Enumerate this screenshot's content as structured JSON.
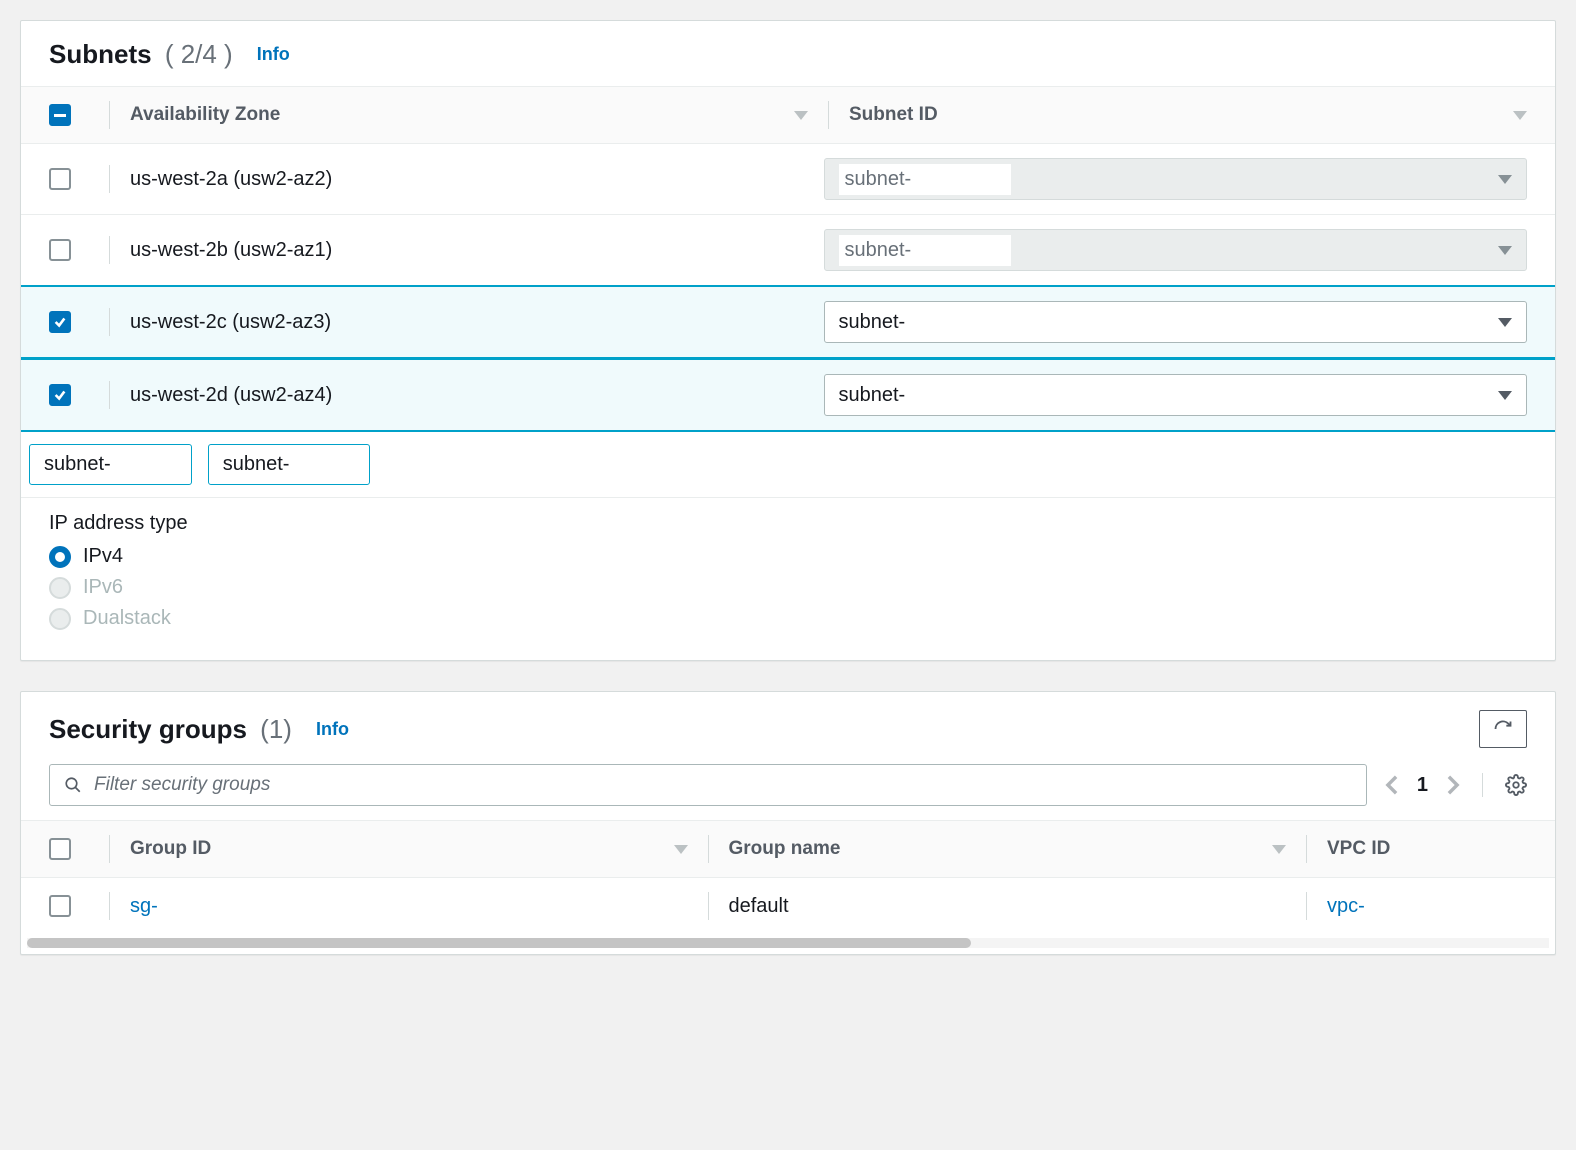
{
  "subnets_panel": {
    "title": "Subnets",
    "count_text": "( 2/4 )",
    "info_label": "Info",
    "columns": {
      "az": "Availability Zone",
      "subnet": "Subnet ID"
    },
    "header_check_state": "indeterminate",
    "rows": [
      {
        "checked": false,
        "az": "us-west-2a (usw2-az2)",
        "subnet_value": "subnet-",
        "disabled": true
      },
      {
        "checked": false,
        "az": "us-west-2b (usw2-az1)",
        "subnet_value": "subnet-",
        "disabled": true
      },
      {
        "checked": true,
        "az": "us-west-2c (usw2-az3)",
        "subnet_value": "subnet-",
        "disabled": false
      },
      {
        "checked": true,
        "az": "us-west-2d (usw2-az4)",
        "subnet_value": "subnet-",
        "disabled": false
      }
    ],
    "tokens": [
      "subnet-",
      "subnet-"
    ],
    "ip_section_title": "IP address type",
    "ip_options": [
      {
        "label": "IPv4",
        "selected": true,
        "disabled": false
      },
      {
        "label": "IPv6",
        "selected": false,
        "disabled": true
      },
      {
        "label": "Dualstack",
        "selected": false,
        "disabled": true
      }
    ]
  },
  "sg_panel": {
    "title": "Security groups",
    "count_text": "(1)",
    "info_label": "Info",
    "filter_placeholder": "Filter security groups",
    "page_number": "1",
    "columns": {
      "group_id": "Group ID",
      "group_name": "Group name",
      "vpc_id": "VPC ID"
    },
    "rows": [
      {
        "checked": false,
        "group_id": "sg-",
        "group_name": "default",
        "vpc_id": "vpc-"
      }
    ]
  }
}
